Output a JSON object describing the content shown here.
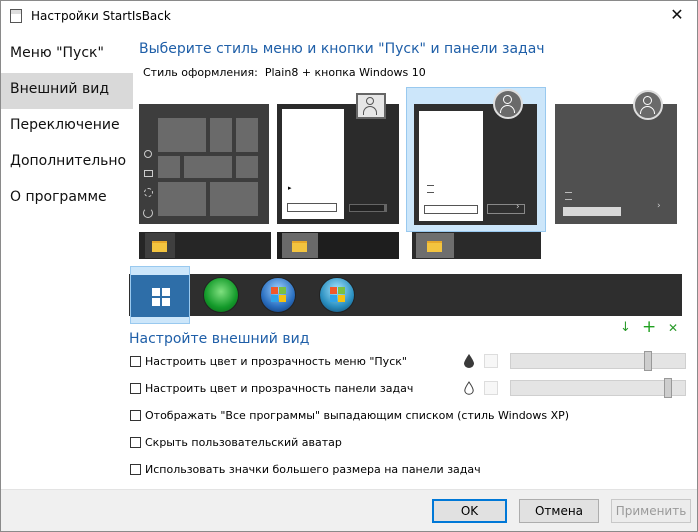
{
  "window": {
    "title": "Настройки StartIsBack"
  },
  "nav": [
    {
      "label": "Меню \"Пуск\""
    },
    {
      "label": "Внешний вид"
    },
    {
      "label": "Переключение"
    },
    {
      "label": "Дополнительно"
    },
    {
      "label": "О программе"
    }
  ],
  "main": {
    "heading": "Выберите стиль меню и кнопки \"Пуск\" и панели задач",
    "style_label": "Стиль оформления:",
    "style_value": "Plain8 + кнопка Windows 10",
    "section2_heading": "Настройте внешний вид",
    "options": [
      {
        "label": "Настроить цвет и прозрачность меню \"Пуск\""
      },
      {
        "label": "Настроить цвет и прозрачность панели задач"
      },
      {
        "label": "Отображать \"Все программы\" выпадающим списком (стиль Windows XP)"
      },
      {
        "label": "Скрыть пользовательский аватар"
      },
      {
        "label": "Использовать значки большего размера на панели задач"
      }
    ],
    "sliders": [
      {
        "level_percent": 80
      },
      {
        "level_percent": 92
      }
    ]
  },
  "icons": {
    "download": "↓",
    "add": "+",
    "remove": "✕"
  },
  "buttons": {
    "ok": "OK",
    "cancel": "Отмена",
    "apply": "Применить"
  },
  "colors": {
    "accent": "#1f5fa8",
    "selection": "#cce6fa",
    "add_green": "#20a020"
  }
}
